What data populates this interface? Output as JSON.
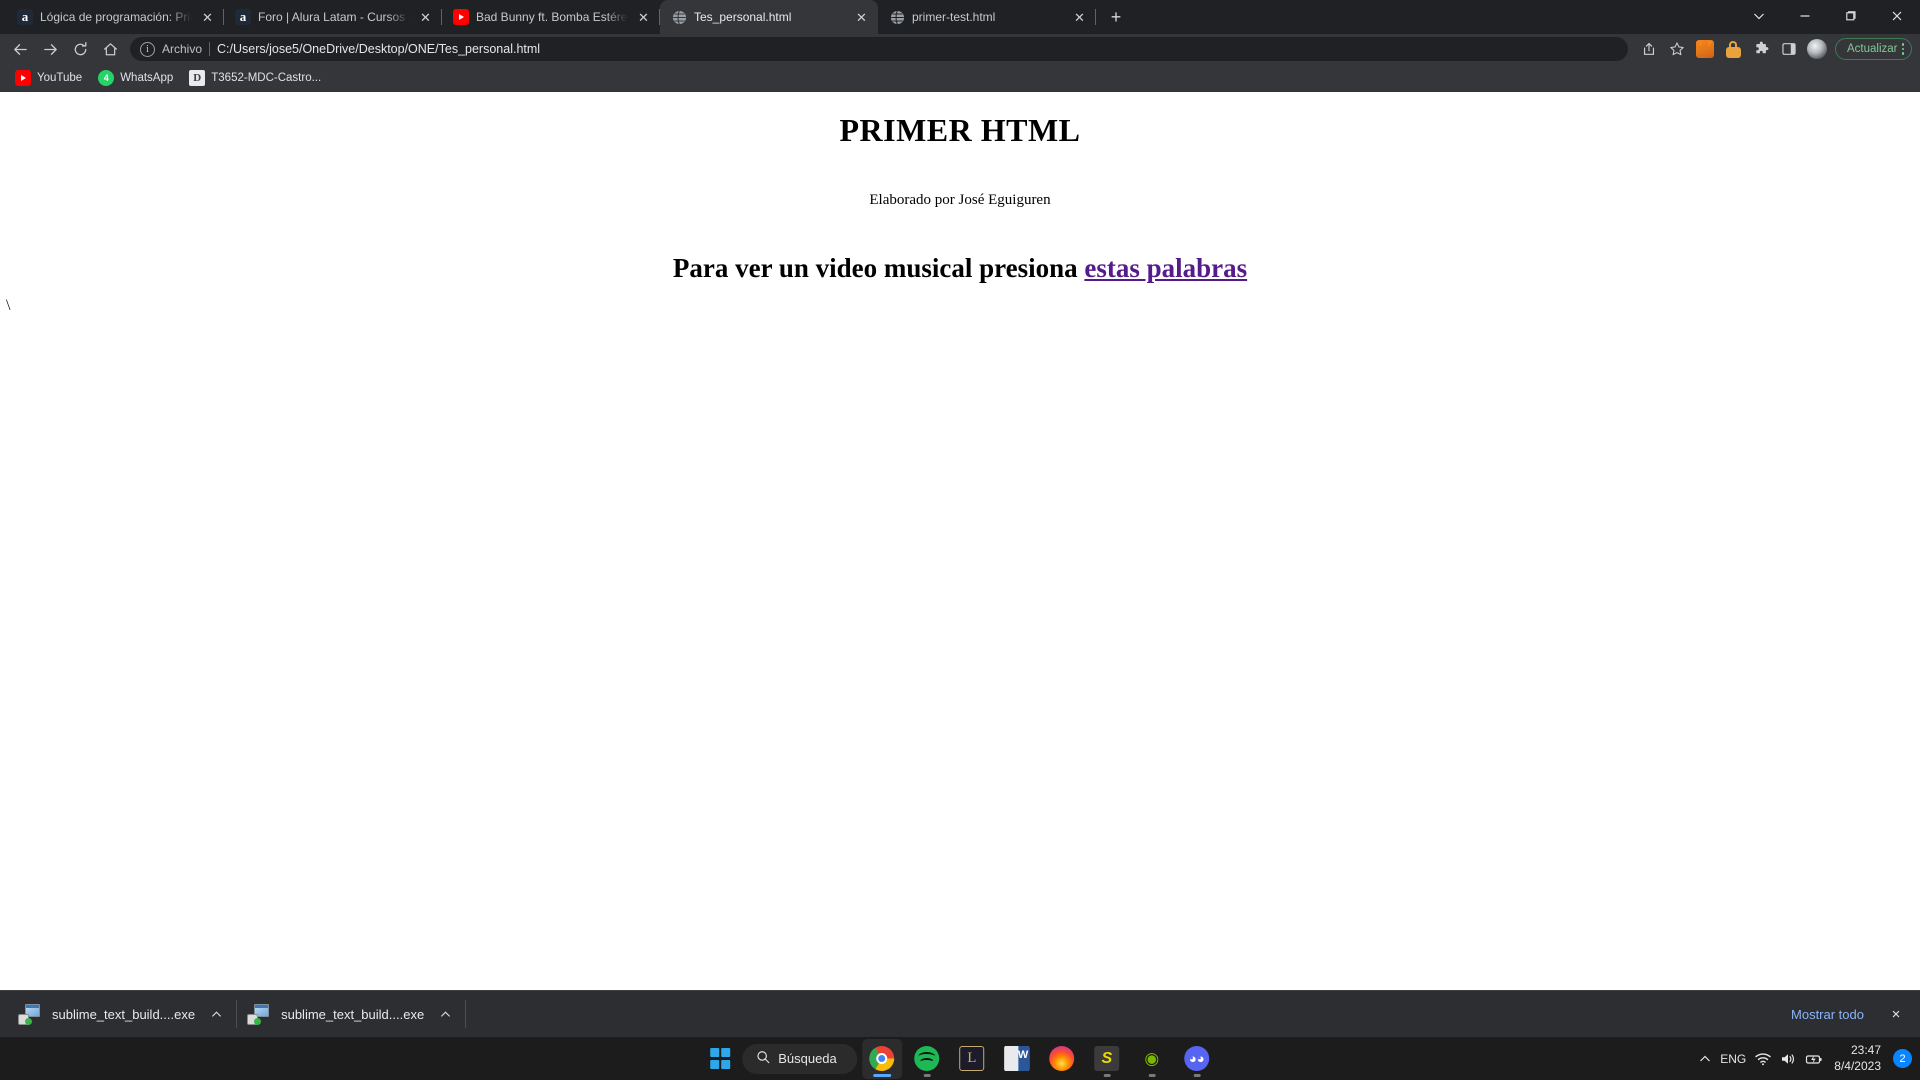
{
  "browser": {
    "tabs": [
      {
        "title": "Lógica de programación: Primero",
        "favicon": "alura-icon",
        "active": false
      },
      {
        "title": "Foro | Alura Latam - Cursos onlin",
        "favicon": "alura-icon",
        "active": false
      },
      {
        "title": "Bad Bunny ft. Bomba Estéreo - O",
        "favicon": "youtube-icon",
        "active": false
      },
      {
        "title": "Tes_personal.html",
        "favicon": "globe-icon",
        "active": true
      },
      {
        "title": "primer-test.html",
        "favicon": "globe-icon",
        "active": false
      }
    ],
    "new_tab_label": "+",
    "window_controls": {
      "tab_search": "tab-search-icon",
      "minimize": "minimize-icon",
      "maximize": "maximize-icon",
      "close": "close-icon"
    },
    "omnibox": {
      "scheme_label": "Archivo",
      "url": "C:/Users/jose5/OneDrive/Desktop/ONE/Tes_personal.html"
    },
    "toolbar_icons": [
      "share-icon",
      "bookmark-star-icon",
      "metamask-extension-icon",
      "password-lock-extension-icon",
      "extensions-puzzle-icon",
      "side-panel-icon",
      "profile-avatar"
    ],
    "update_button": {
      "label": "Actualizar",
      "accent_color": "#81c995"
    },
    "bookmarks": [
      {
        "label": "YouTube",
        "icon": "youtube-icon"
      },
      {
        "label": "WhatsApp",
        "icon": "whatsapp-icon",
        "badge": "4"
      },
      {
        "label": "T3652-MDC-Castro...",
        "icon": "document-icon"
      }
    ]
  },
  "page": {
    "heading": "PRIMER HTML",
    "byline": "Elaborado por José Eguiguren",
    "cta_text": "Para ver un video musical presiona ",
    "cta_link": "estas palabras",
    "stray_text": "\\",
    "link_color": "#551a8b"
  },
  "downloads_bar": {
    "items": [
      {
        "filename": "sublime_text_build....exe",
        "icon": "installer-icon",
        "menu": "chevron-up-icon"
      },
      {
        "filename": "sublime_text_build....exe",
        "icon": "installer-icon",
        "menu": "chevron-up-icon"
      }
    ],
    "show_all_label": "Mostrar todo",
    "close_label": "×",
    "show_all_color": "#8ab4f8"
  },
  "taskbar": {
    "start_label": "start-icon",
    "search_placeholder": "Búsqueda",
    "apps": [
      {
        "name": "chrome",
        "label": "Google Chrome",
        "active": true
      },
      {
        "name": "spotify",
        "label": "Spotify",
        "active": false
      },
      {
        "name": "league-of-legends",
        "label": "League of Legends",
        "active": false
      },
      {
        "name": "word",
        "label": "Microsoft Word",
        "active": false
      },
      {
        "name": "firefox",
        "label": "Mozilla Firefox",
        "active": false
      },
      {
        "name": "sublime-text",
        "label": "Sublime Text",
        "active": false
      },
      {
        "name": "nvidia",
        "label": "NVIDIA",
        "active": false
      },
      {
        "name": "discord",
        "label": "Discord",
        "active": false
      }
    ],
    "tray": {
      "overflow": "chevron-up-icon",
      "language": "ENG",
      "wifi": "wifi-icon",
      "volume": "volume-icon",
      "battery": "battery-icon",
      "time": "23:47",
      "date": "8/4/2023",
      "notifications": "2"
    }
  }
}
